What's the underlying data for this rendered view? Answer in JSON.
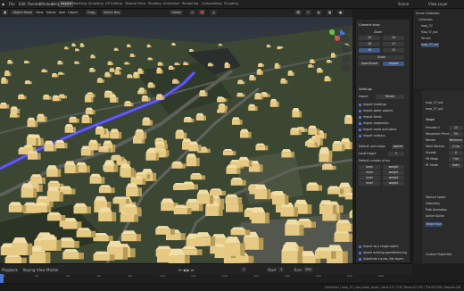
{
  "menubar": {
    "items": [
      "File",
      "Edit",
      "Render",
      "Window",
      "Help"
    ],
    "workspaces": [
      "Layout",
      "Modeling",
      "Sculpting",
      "UV Editing",
      "Texture Paint",
      "Shading",
      "Animation",
      "Rendering",
      "Compositing",
      "Scripting"
    ],
    "active_workspace": "Layout",
    "scene": "Scene",
    "view_layer": "View Layer"
  },
  "viewport_header": {
    "mode": "Object Mode",
    "view": "View",
    "select": "Select",
    "add": "Add",
    "object": "Object",
    "orientation": "Global",
    "drag": "Drag",
    "select_box": "Select Box"
  },
  "npanel": {
    "camera_title": "Camera view",
    "zoom_title": "Zoom",
    "zoom_values": [
      "20",
      "19",
      "18",
      "17",
      "16",
      "15"
    ],
    "scale_label": "Scale",
    "openstreet": "OpenStreet",
    "import_label": "Import",
    "settings_title": "Settings",
    "import_row_label": "Import",
    "import_value": "Terrain",
    "options": [
      "Import buildings",
      "Import water objects",
      "Import forest",
      "Import vegetation",
      "Import roads and paths",
      "Import railways"
    ],
    "mode_label": "Default roof shape",
    "mode_value": "gabled",
    "level_height_label": "Level height",
    "level_height_value": "3",
    "default_levels_label": "Default number of lev",
    "levels_grid": [
      "level",
      "weight",
      "level",
      "weight",
      "level",
      "weight",
      "level",
      "weight"
    ],
    "bottom_options": [
      "Import as a single object",
      "Ignore existing georeferencing",
      "Subdivide curves, flat layers"
    ],
    "load_missing": "Load missing members"
  },
  "outliner": {
    "title": "Scene Collection",
    "rows": [
      "Scene Collection",
      "Collection",
      "map_37",
      "Map 37_out",
      "Terrain",
      "map_37_out"
    ]
  },
  "properties": {
    "object_rows": [
      "map_37_out",
      "map_37_out"
    ],
    "shape_title": "Shape",
    "shape_rows": [
      "Preview U",
      "Resolution Preview U",
      "Render",
      "Twist Method",
      "Smooth",
      "Fill Mode",
      "Rl. Mode"
    ],
    "shape_values": [
      "12",
      "Tilt",
      "Minimum",
      "Z-Up",
      "0",
      "Full",
      "Both"
    ],
    "sections": [
      "Texture Space",
      "Geometry",
      "Path Animation",
      "Active Spline",
      "Shape Keys",
      "Custom Properties"
    ]
  },
  "timeline": {
    "playback": "Playback",
    "keying": "Keying",
    "view": "View",
    "marker": "Marker",
    "current_frame": "1",
    "start_label": "Start",
    "start": "1",
    "end_label": "End",
    "end": "250",
    "ticks": [
      "0",
      "20",
      "40",
      "60",
      "80",
      "100",
      "120",
      "140",
      "160",
      "180",
      "200",
      "220",
      "240"
    ]
  },
  "statusbar": {
    "text": "Collection | map_37 | out_roads_lanes | Verts:117,718 | Faces:47,152 | Tris:95,506 | Objects:1/8"
  },
  "colors": {
    "accent_blue": "#4a74c9",
    "building": "#e6c982",
    "road_blue": "#4a43d8",
    "terrain": "#3b4633"
  }
}
